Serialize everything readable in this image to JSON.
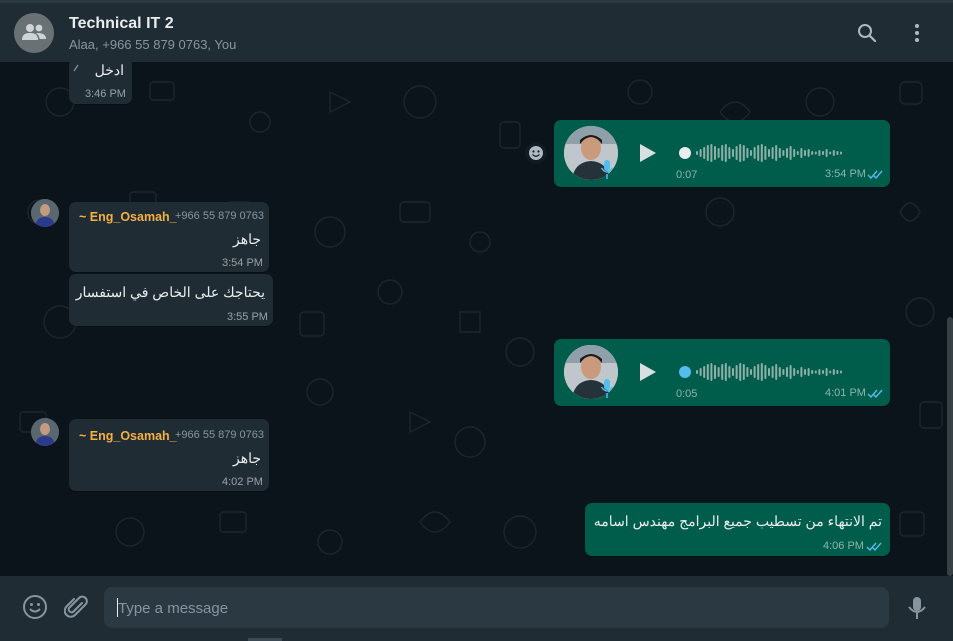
{
  "header": {
    "title": "Technical IT 2",
    "participants": "Alaa, +966 55 879 0763, You",
    "avatar_icon": "group-icon",
    "search_icon": "search-icon",
    "menu_icon": "kebab-menu-icon"
  },
  "messages": {
    "m1": {
      "text": "ادخل",
      "time": "3:46 PM"
    },
    "v1": {
      "duration": "0:07",
      "time": "3:54 PM"
    },
    "m2": {
      "sender": "~ Eng_Osamah_",
      "phone": "+966 55 879 0763",
      "text": "جاهز",
      "time": "3:54 PM"
    },
    "m3": {
      "text": "يحتاجك على الخاص في استفسار",
      "time": "3:55 PM"
    },
    "v2": {
      "duration": "0:05",
      "time": "4:01 PM"
    },
    "m4": {
      "sender": "~ Eng_Osamah_",
      "phone": "+966 55 879 0763",
      "text": "جاهز",
      "time": "4:02 PM"
    },
    "m5": {
      "text": "تم الانتهاء من تسطيب جميع البرامج مهندس اسامه",
      "time": "4:06 PM"
    }
  },
  "composer": {
    "placeholder": "Type a message",
    "emoji_icon": "emoji-icon",
    "attach_icon": "paperclip-icon",
    "mic_icon": "microphone-icon"
  },
  "colors": {
    "incoming_bubble": "#202c33",
    "outgoing_bubble": "#005c4b",
    "sender_name": "#f5b044",
    "read_ticks": "#53bdeb"
  }
}
